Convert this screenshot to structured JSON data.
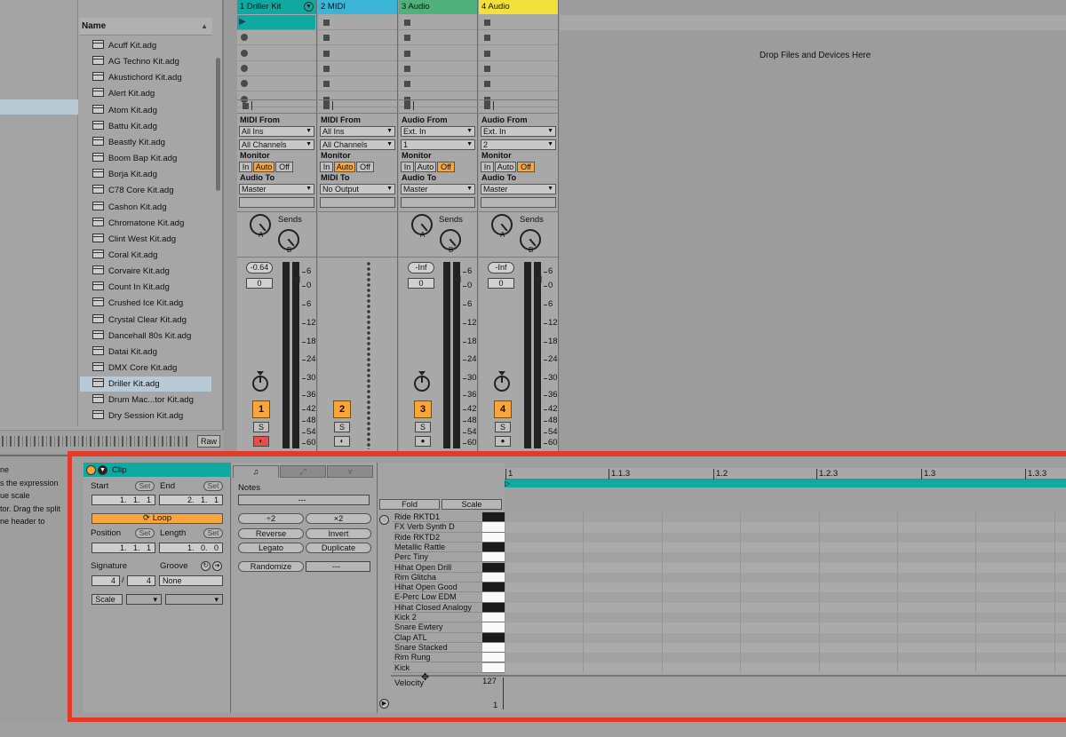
{
  "browser": {
    "name_header": "Name",
    "items": [
      "Acuff Kit.adg",
      "AG Techno Kit.adg",
      "Akustichord Kit.adg",
      "Alert Kit.adg",
      "Atom Kit.adg",
      "Battu Kit.adg",
      "Beastly Kit.adg",
      "Boom Bap Kit.adg",
      "Borja Kit.adg",
      "C78 Core Kit.adg",
      "Cashon Kit.adg",
      "Chromatone Kit.adg",
      "Clint West Kit.adg",
      "Coral Kit.adg",
      "Corvaire Kit.adg",
      "Count In Kit.adg",
      "Crushed Ice Kit.adg",
      "Crystal Clear Kit.adg",
      "Dancehall 80s Kit.adg",
      "Datai Kit.adg",
      "DMX Core Kit.adg",
      "Driller Kit.adg",
      "Drum Mac...tor Kit.adg",
      "Dry Session Kit.adg"
    ],
    "selected_item": "Driller Kit.adg",
    "raw_button": "Raw"
  },
  "tracks": [
    {
      "name": "1 Driller Kit",
      "color": "#10a9a1",
      "from_label": "MIDI From",
      "from": "All Ins",
      "channel": "All Channels",
      "monitor_label": "Monitor",
      "monitor": [
        "In",
        "Auto",
        "Off"
      ],
      "monitor_on": 1,
      "to_label": "Audio To",
      "to": "Master",
      "sends_label": "Sends",
      "volume": "-0.64",
      "pan": "0",
      "number": "1",
      "solo": "S"
    },
    {
      "name": "2 MIDI",
      "color": "#3bb4d8",
      "from_label": "MIDI From",
      "from": "All Ins",
      "channel": "All Channels",
      "monitor_label": "Monitor",
      "monitor": [
        "In",
        "Auto",
        "Off"
      ],
      "monitor_on": 1,
      "to_label": "MIDI To",
      "to": "No Output",
      "number": "2",
      "solo": "S"
    },
    {
      "name": "3 Audio",
      "color": "#4fb27a",
      "from_label": "Audio From",
      "from": "Ext. In",
      "channel": "1",
      "monitor_label": "Monitor",
      "monitor": [
        "In",
        "Auto",
        "Off"
      ],
      "monitor_on": 2,
      "to_label": "Audio To",
      "to": "Master",
      "sends_label": "Sends",
      "volume": "-Inf",
      "pan": "0",
      "number": "3",
      "solo": "S"
    },
    {
      "name": "4 Audio",
      "color": "#f3e03a",
      "from_label": "Audio From",
      "from": "Ext. In",
      "channel": "2",
      "monitor_label": "Monitor",
      "monitor": [
        "In",
        "Auto",
        "Off"
      ],
      "monitor_on": 2,
      "to_label": "Audio To",
      "to": "Master",
      "sends_label": "Sends",
      "volume": "-Inf",
      "pan": "0",
      "number": "4",
      "solo": "S"
    }
  ],
  "send_labels": [
    "A",
    "B"
  ],
  "db_scale": [
    "6",
    "0",
    "6",
    "12",
    "18",
    "24",
    "30",
    "36",
    "42",
    "48",
    "54",
    "60"
  ],
  "drop_area": {
    "text": "Drop Files and Devices Here"
  },
  "info_text": [
    "ne",
    "s the expression",
    "ue scale",
    "tor. Drag the split",
    "ne header to"
  ],
  "clip": {
    "title": "Clip",
    "start_label": "Start",
    "end_label": "End",
    "set": "Set",
    "start": "1.   1.   1",
    "end": "2.   1.   1",
    "loop": "Loop",
    "position_label": "Position",
    "length_label": "Length",
    "position": "1.   1.   1",
    "length": "1.   0.   0",
    "signature_label": "Signature",
    "groove_label": "Groove",
    "sig_num": "4",
    "sig_den": "4",
    "groove": "None",
    "scale": "Scale"
  },
  "notes": {
    "label": "Notes",
    "value": "---",
    "buttons": [
      "÷2",
      "×2",
      "Reverse",
      "Invert",
      "Legato",
      "Duplicate",
      "Randomize",
      "---"
    ]
  },
  "piano": {
    "fold": "Fold",
    "scale": "Scale",
    "keys": [
      "Ride RKTD1",
      "FX Verb Synth D",
      "Ride RKTD2",
      "Metallic Rattle",
      "Perc Tiny",
      "Hihat Open Drill",
      "Rim Glitcha",
      "Hihat Open Good",
      "E-Perc Low EDM",
      "Hihat Closed Analogy",
      "Kick 2",
      "Snare Ewtery",
      "Clap ATL",
      "Snare Stacked",
      "Rim Rung",
      "Kick"
    ],
    "key_colors": [
      "b",
      "w",
      "w",
      "b",
      "w",
      "b",
      "w",
      "b",
      "w",
      "b",
      "w",
      "w",
      "b",
      "w",
      "w",
      "w"
    ],
    "velocity_label": "Velocity",
    "vel_max": "127",
    "vel_min": "1"
  },
  "ruler": [
    "1",
    "1.1.3",
    "1.2",
    "1.2.3",
    "1.3",
    "1.3.3"
  ],
  "colors": {
    "accent_orange": "#f9a53b",
    "clip_teal": "#10a9a1",
    "highlight": "#e23b2a"
  }
}
